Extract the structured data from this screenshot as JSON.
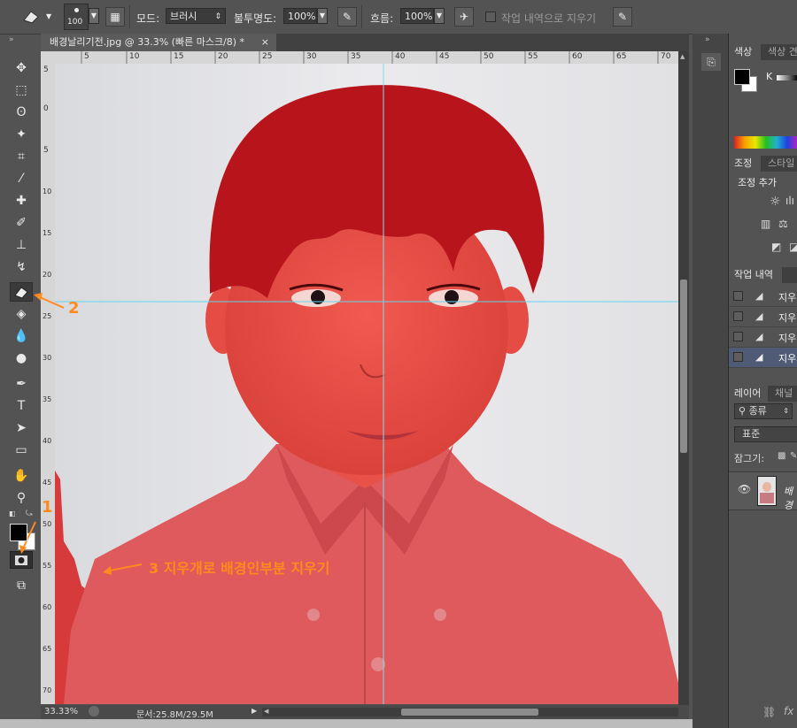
{
  "options_bar": {
    "brush_size": "100",
    "mode_label": "모드:",
    "mode_value": "브러시",
    "opacity_label": "불투명도:",
    "opacity_value": "100%",
    "flow_label": "흐름:",
    "flow_value": "100%",
    "erase_history_label": "작업 내역으로 지우기"
  },
  "document": {
    "tab_title": "배경날리기전.jpg @ 33.3% (빠른 마스크/8) *",
    "close_glyph": "×",
    "ruler_top": [
      "5",
      "10",
      "15",
      "20",
      "25",
      "30",
      "35",
      "40",
      "45",
      "50",
      "55",
      "60",
      "65",
      "70"
    ],
    "ruler_left": [
      "5",
      "0",
      "5",
      "10",
      "15",
      "20",
      "25",
      "30",
      "35",
      "40",
      "45",
      "50",
      "55",
      "60",
      "65",
      "70"
    ]
  },
  "status_bar": {
    "zoom": "33.33%",
    "doc_size": "문서:25.8M/29.5M"
  },
  "annotations": {
    "num1": "1",
    "num2": "2",
    "num3_text": "3 지우개로 배경인부분 지우기"
  },
  "right_panel": {
    "tab_color": "색상",
    "tab_swatches": "색상 견",
    "k_label": "K",
    "tab_adjust": "조정",
    "tab_style": "스타일",
    "adjust_add": "조정 추가",
    "history_tab": "작업 내역",
    "history_items": [
      "지우",
      "지우",
      "지우",
      "지우"
    ],
    "layers_tab": "레이어",
    "channels_tab": "채널",
    "kind_filter": "종류",
    "blend_mode": "표준",
    "lock_label": "잠그기:",
    "layer_name": "배경"
  },
  "colors": {
    "mask_red": "#d42a2a",
    "annotation_orange": "#ff8a1d",
    "guide_cyan": "#34d6ee",
    "ui_dark": "#535353"
  }
}
